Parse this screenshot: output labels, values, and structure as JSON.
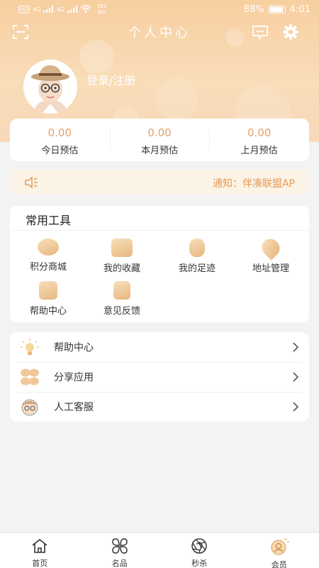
{
  "status_bar": {
    "hd": "HD",
    "signal1": "4G",
    "signal2": "4G",
    "net_speed": "352",
    "net_unit": "B/s",
    "battery": "88%",
    "time": "4:01"
  },
  "header": {
    "title": "个人中心",
    "login_label": "登录/注册"
  },
  "stats": [
    {
      "value": "0.00",
      "label": "今日预估"
    },
    {
      "value": "0.00",
      "label": "本月预估"
    },
    {
      "value": "0.00",
      "label": "上月预估"
    }
  ],
  "notice": {
    "text": "通知：伴凑联盟AP"
  },
  "tools": {
    "title": "常用工具",
    "items": [
      {
        "label": "积分商城",
        "icon": "piggy-bank-icon"
      },
      {
        "label": "我的收藏",
        "icon": "folder-icon"
      },
      {
        "label": "我的足迹",
        "icon": "footprint-icon"
      },
      {
        "label": "地址管理",
        "icon": "location-pin-icon"
      },
      {
        "label": "帮助中心",
        "icon": "help-box-icon"
      },
      {
        "label": "意见反馈",
        "icon": "feedback-icon"
      }
    ]
  },
  "menu": [
    {
      "label": "帮助中心",
      "icon": "lightbulb-icon"
    },
    {
      "label": "分享应用",
      "icon": "clover-share-icon"
    },
    {
      "label": "人工客服",
      "icon": "service-avatar-icon"
    }
  ],
  "tabbar": [
    {
      "label": "首页",
      "icon": "home-icon"
    },
    {
      "label": "名品",
      "icon": "grid-flower-icon"
    },
    {
      "label": "秒杀",
      "icon": "aperture-icon"
    },
    {
      "label": "会员",
      "icon": "member-icon",
      "active": true
    }
  ],
  "colors": {
    "header_gradient_top": "#f7cfa0",
    "accent": "#e0a06a",
    "notice_text": "#e59a57"
  }
}
